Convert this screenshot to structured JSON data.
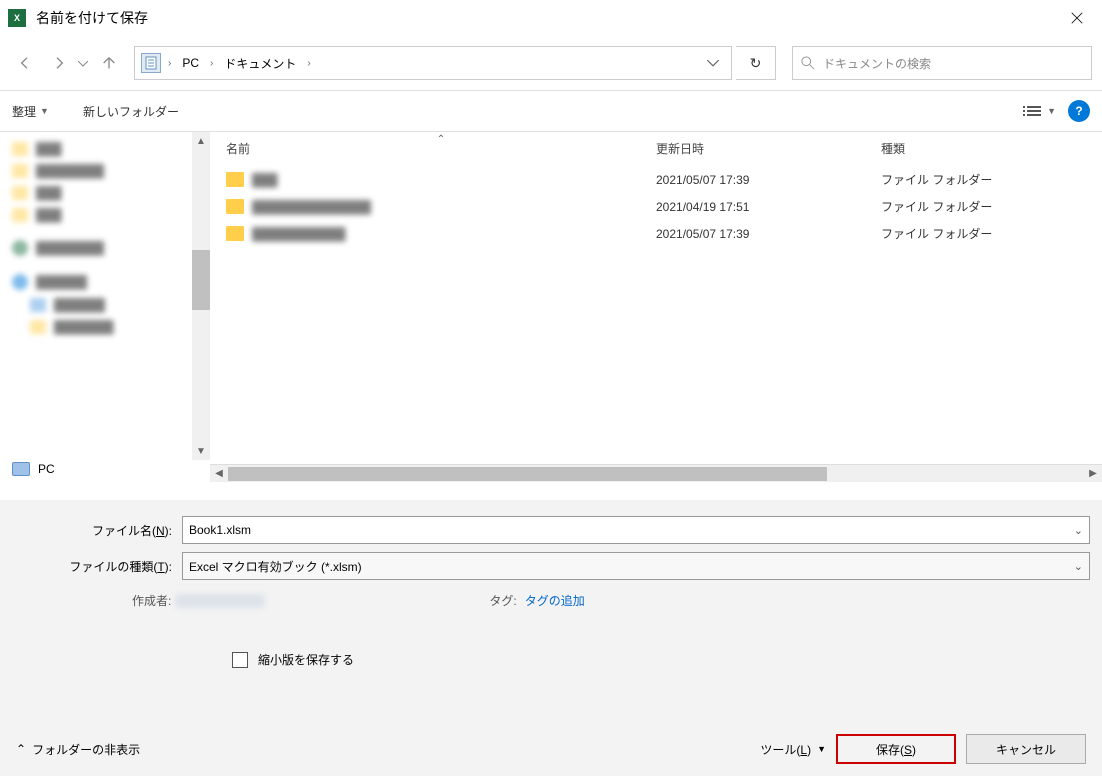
{
  "title": "名前を付けて保存",
  "breadcrumb": {
    "root": "PC",
    "folder": "ドキュメント"
  },
  "search": {
    "placeholder": "ドキュメントの検索"
  },
  "toolbar": {
    "organize": "整理",
    "newfolder": "新しいフォルダー"
  },
  "columns": {
    "name": "名前",
    "modified": "更新日時",
    "type": "種類"
  },
  "rows": [
    {
      "date": "2021/05/07 17:39",
      "type": "ファイル フォルダー"
    },
    {
      "date": "2021/04/19 17:51",
      "type": "ファイル フォルダー"
    },
    {
      "date": "2021/05/07 17:39",
      "type": "ファイル フォルダー"
    }
  ],
  "sidebar_pc": "PC",
  "fields": {
    "filename_label": "ファイル名(N):",
    "filename_value": "Book1.xlsm",
    "filetype_label": "ファイルの種類(T):",
    "filetype_value": "Excel マクロ有効ブック (*.xlsm)",
    "author_label": "作成者:",
    "tags_label": "タグ:",
    "tags_add": "タグの追加",
    "thumbnail": "縮小版を保存する"
  },
  "footer": {
    "hide_folders": "フォルダーの非表示",
    "tools": "ツール(L)",
    "save": "保存(S)",
    "cancel": "キャンセル"
  }
}
